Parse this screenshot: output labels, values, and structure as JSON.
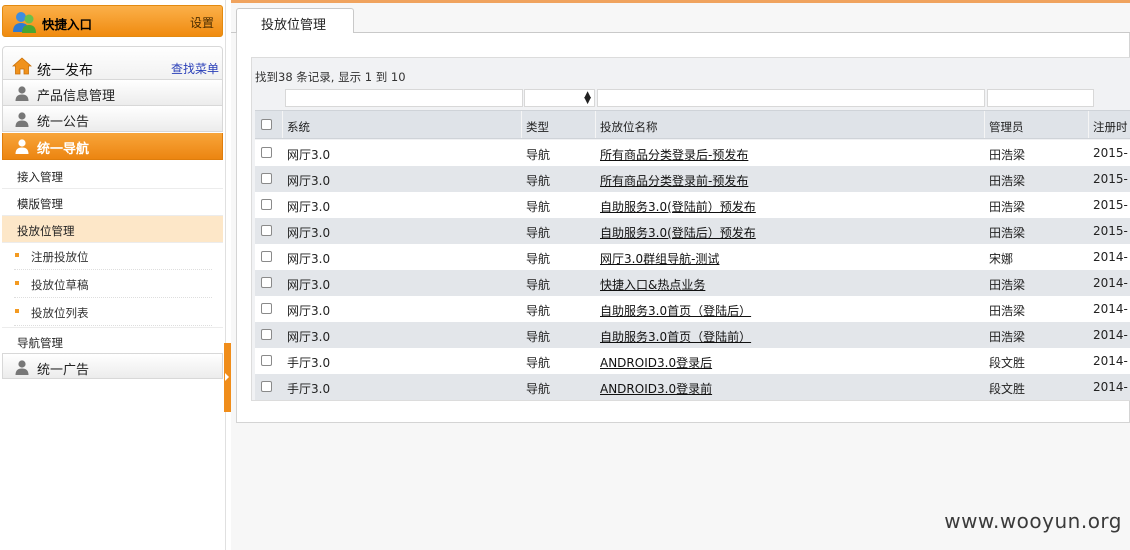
{
  "sidebar": {
    "quick_entry_title": "快捷入口",
    "settings_label": "设置",
    "publish_title": "统一发布",
    "find_menu_label": "查找菜单",
    "modules": [
      {
        "label": "产品信息管理"
      },
      {
        "label": "统一公告"
      },
      {
        "label": "统一导航"
      }
    ],
    "nav_subitems": [
      {
        "label": "接入管理"
      },
      {
        "label": "模版管理"
      },
      {
        "label": "投放位管理"
      }
    ],
    "placement_leaves": [
      {
        "label": "注册投放位"
      },
      {
        "label": "投放位草稿"
      },
      {
        "label": "投放位列表"
      }
    ],
    "nav_mgmt_label": "导航管理",
    "ad_module_label": "统一广告"
  },
  "main": {
    "tab_label": "投放位管理",
    "records_info": "找到38 条记录, 显示 1 到 10",
    "columns": {
      "system": "系统",
      "type": "类型",
      "name": "投放位名称",
      "admin": "管理员",
      "reg_time": "注册时"
    },
    "rows": [
      {
        "system": "网厅3.0",
        "type": "导航",
        "name": "所有商品分类登录后-预发布",
        "admin": "田浩梁",
        "date": "2015-"
      },
      {
        "system": "网厅3.0",
        "type": "导航",
        "name": "所有商品分类登录前-预发布",
        "admin": "田浩梁",
        "date": "2015-"
      },
      {
        "system": "网厅3.0",
        "type": "导航",
        "name": "自助服务3.0(登陆前）预发布",
        "admin": "田浩梁",
        "date": "2015-"
      },
      {
        "system": "网厅3.0",
        "type": "导航",
        "name": "自助服务3.0(登陆后）预发布",
        "admin": "田浩梁",
        "date": "2015-"
      },
      {
        "system": "网厅3.0",
        "type": "导航",
        "name": "网厅3.0群组导航-测试",
        "admin": "宋娜",
        "date": "2014-"
      },
      {
        "system": "网厅3.0",
        "type": "导航",
        "name": "快捷入口&热点业务",
        "admin": "田浩梁",
        "date": "2014-"
      },
      {
        "system": "网厅3.0",
        "type": "导航",
        "name": "自助服务3.0首页（登陆后）",
        "admin": "田浩梁",
        "date": "2014-"
      },
      {
        "system": "网厅3.0",
        "type": "导航",
        "name": "自助服务3.0首页（登陆前）",
        "admin": "田浩梁",
        "date": "2014-"
      },
      {
        "system": "手厅3.0",
        "type": "导航",
        "name": "ANDROID3.0登录后",
        "admin": "段文胜",
        "date": "2014-"
      },
      {
        "system": "手厅3.0",
        "type": "导航",
        "name": "ANDROID3.0登录前",
        "admin": "段文胜",
        "date": "2014-"
      }
    ]
  },
  "watermark": "www.wooyun.org",
  "colors": {
    "accent_orange": "#f08b0f",
    "selected_bg": "#fde7c8",
    "header_gray": "#dfe3e8",
    "link_blue": "#2a3fb8"
  }
}
